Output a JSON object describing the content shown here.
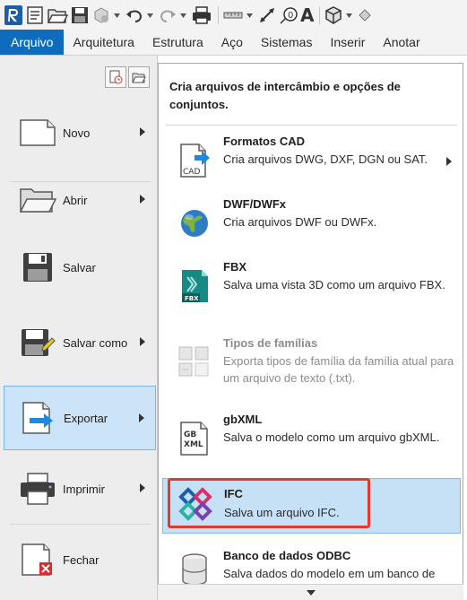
{
  "colors": {
    "accent": "#0f6cbd",
    "selection": "#cce4f7",
    "highlight_outline": "#e23a2e",
    "disabled_text": "#8d8d8d"
  },
  "quick_access": {
    "items": [
      "app-logo",
      "properties-icon",
      "open-icon",
      "save-icon",
      "sync-icon",
      "undo-icon",
      "redo-icon",
      "print-icon",
      "measure-icon",
      "dimension-icon",
      "tag-icon",
      "text-icon",
      "3d-view-icon",
      "more-icon"
    ],
    "text_glyph": "A"
  },
  "tabs": [
    {
      "label": "Arquivo",
      "active": true
    },
    {
      "label": "Arquitetura"
    },
    {
      "label": "Estrutura"
    },
    {
      "label": "Aço"
    },
    {
      "label": "Sistemas"
    },
    {
      "label": "Inserir"
    },
    {
      "label": "Anotar"
    }
  ],
  "menu": {
    "items": [
      {
        "label": "Novo",
        "icon": "new-document-icon",
        "has_submenu": true
      },
      {
        "label": "Abrir",
        "icon": "folder-open-icon",
        "has_submenu": true
      },
      {
        "label": "Salvar",
        "icon": "floppy-disk-icon",
        "has_submenu": false
      },
      {
        "label": "Salvar como",
        "icon": "save-as-icon",
        "has_submenu": true
      },
      {
        "label": "Exportar",
        "icon": "export-icon",
        "has_submenu": true,
        "selected": true
      },
      {
        "label": "Imprimir",
        "icon": "printer-icon",
        "has_submenu": true
      },
      {
        "label": "Fechar",
        "icon": "close-document-icon",
        "has_submenu": false
      }
    ]
  },
  "submenu": {
    "header": "Cria arquivos de intercâmbio e opções de conjuntos.",
    "items": [
      {
        "title": "Formatos CAD",
        "desc": "Cria arquivos DWG, DXF, DGN ou SAT.",
        "icon": "cad-formats-icon",
        "has_submenu": true
      },
      {
        "title": "DWF/DWFx",
        "desc": "Cria arquivos DWF ou DWFx.",
        "icon": "dwf-globe-icon"
      },
      {
        "title": "FBX",
        "desc": "Salva uma vista 3D como um arquivo FBX.",
        "icon": "fbx-icon"
      },
      {
        "title": "Tipos de famílias",
        "desc": "Exporta tipos de família da família atual para um arquivo de texto (.txt).",
        "icon": "family-types-icon",
        "disabled": true
      },
      {
        "title": "gbXML",
        "desc": "Salva o modelo como um arquivo gbXML.",
        "icon": "gbxml-icon"
      },
      {
        "title": "IFC",
        "desc": "Salva um arquivo IFC.",
        "icon": "ifc-icon",
        "highlighted": true
      },
      {
        "title": "Banco de dados ODBC",
        "desc": "Salva dados do modelo em um banco de",
        "icon": "odbc-database-icon"
      }
    ],
    "icon_text": {
      "cad": "CAD",
      "fbx": "FBX",
      "gbxml_line1": "GB",
      "gbxml_line2": "XML"
    }
  }
}
